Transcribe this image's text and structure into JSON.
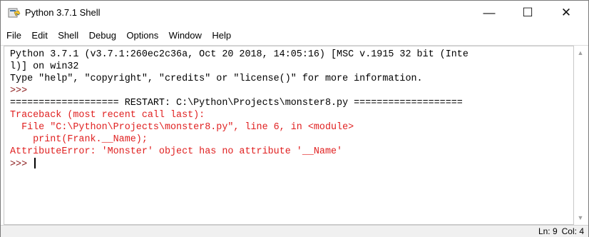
{
  "window": {
    "title": "Python 3.7.1 Shell",
    "controls": {
      "minimize": "—",
      "maximize": "☐",
      "close": "✕"
    }
  },
  "menu": [
    "File",
    "Edit",
    "Shell",
    "Debug",
    "Options",
    "Window",
    "Help"
  ],
  "editor": {
    "lines": [
      {
        "text": "Python 3.7.1 (v3.7.1:260ec2c36a, Oct 20 2018, 14:05:16) [MSC v.1915 32 bit (Inte",
        "style": "normal"
      },
      {
        "text": "l)] on win32",
        "style": "normal"
      },
      {
        "text": "Type \"help\", \"copyright\", \"credits\" or \"license()\" for more information.",
        "style": "normal"
      },
      {
        "text": ">>> ",
        "style": "prompt"
      },
      {
        "text": "=================== RESTART: C:\\Python\\Projects\\monster8.py ===================",
        "style": "restart-eq"
      },
      {
        "text": "Traceback (most recent call last):",
        "style": "error"
      },
      {
        "text": "  File \"C:\\Python\\Projects\\monster8.py\", line 6, in <module>",
        "style": "error"
      },
      {
        "text": "    print(Frank.__Name);",
        "style": "error"
      },
      {
        "text": "AttributeError: 'Monster' object has no attribute '__Name'",
        "style": "error"
      },
      {
        "text": ">>> ",
        "style": "prompt",
        "cursor": true
      }
    ]
  },
  "status": {
    "line": "Ln: 9",
    "col": "Col: 4"
  },
  "colors": {
    "prompt": "#8b1a1a",
    "error": "#e02020",
    "text": "#000000"
  },
  "icons": {
    "app": "python-idle-icon",
    "scroll_up": "chevron-up-icon",
    "scroll_down": "chevron-down-icon"
  }
}
